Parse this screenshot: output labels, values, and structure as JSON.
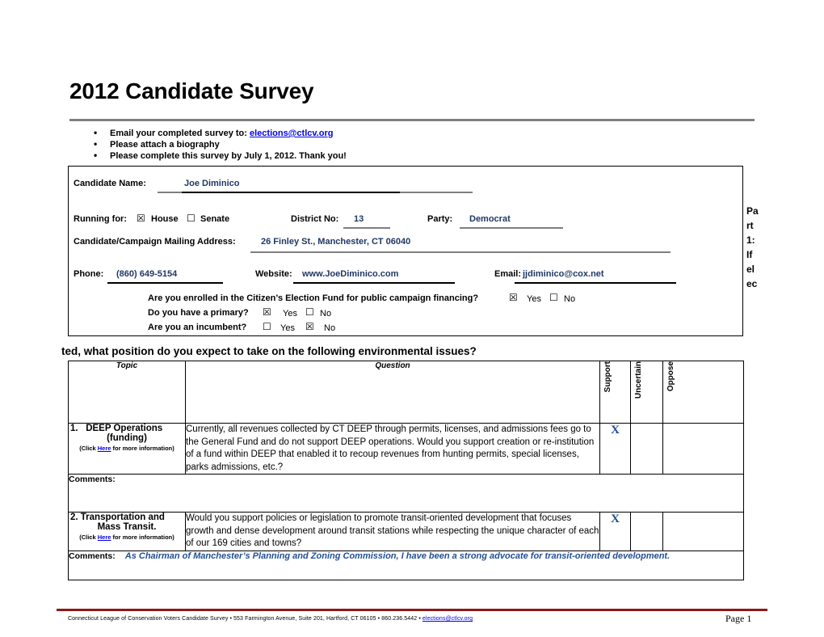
{
  "document": {
    "title": "2012 Candidate Survey",
    "instructions": [
      {
        "bullet": "•",
        "text_before": "Email your completed survey to: ",
        "link": "elections@ctlcv.org"
      },
      {
        "bullet": "•",
        "text_before": "Please attach a biography",
        "link": ""
      },
      {
        "bullet": "•",
        "text_before": "Please complete this survey by July 1, 2012.  Thank you!",
        "link": ""
      }
    ]
  },
  "candidate": {
    "name_label": "Candidate Name:",
    "name_value": "Joe Diminico",
    "running_for_label": "Running for:",
    "house_box": "☒",
    "house_label": "House",
    "senate_box": "☐",
    "senate_label": "Senate",
    "district_label": "District No:",
    "district_value": "13",
    "party_label": "Party:",
    "party_value": "Democrat",
    "address_label": "Candidate/Campaign Mailing Address:",
    "address_value": "26 Finley St., Manchester, CT 06040",
    "phone_label": "Phone:",
    "phone_value": "(860) 649-5154",
    "website_label": "Website:",
    "website_value": "www.JoeDiminico.com",
    "email_label": "Email:",
    "email_value": "jjdiminico@cox.net",
    "cef_question": "Are you enrolled in the Citizen’s Election Fund for public campaign financing?",
    "cef_yes_box": "☒",
    "cef_yes_label": "Yes",
    "cef_no_box": "☐",
    "cef_no_label": "No",
    "primary_question": "Do you have a primary?",
    "primary_yes_box": "☒",
    "primary_yes_label": "Yes",
    "primary_no_box": "☐",
    "primary_no_label": "No",
    "incumbent_question": "Are you an incumbent?",
    "incumbent_yes_box": "☐",
    "incumbent_yes_label": "Yes",
    "incumbent_no_box": "☒",
    "incumbent_no_label": "No"
  },
  "part_label": "Part 1: If elec",
  "continuation": "ted, what position do you expect to take on the following environmental issues?",
  "table": {
    "headers": {
      "topic": "Topic",
      "question": "Question",
      "support": "Support",
      "uncertain": "Uncertain",
      "oppose": "Oppose"
    },
    "rows": [
      {
        "number": "1.",
        "topic": "DEEP Operations",
        "topic_line2": "(funding)",
        "clicknote_before": "(Click ",
        "clicknote_link": "Here",
        "clicknote_after": " for more information)",
        "question": "Currently, all revenues collected by CT DEEP through permits, licenses, and admissions fees go to the General Fund and do not support DEEP operations.  Would you support creation or re-institution of a fund within DEEP that enabled it to recoup revenues from hunting permits, special licenses, parks admissions, etc.?",
        "support_mark": "X",
        "uncertain_mark": "",
        "oppose_mark": "",
        "comments_label": "Comments:",
        "comments_value": ""
      },
      {
        "number": "2.",
        "topic": "Transportation and",
        "topic_line2": "Mass Transit.",
        "clicknote_before": "(Click ",
        "clicknote_link": "Here",
        "clicknote_after": " for more information)",
        "question": "Would you support policies or legislation to promote transit-oriented development that focuses growth and dense development around transit stations while respecting the unique character of each of our 169 cities and towns?",
        "support_mark": "X",
        "uncertain_mark": "",
        "oppose_mark": "",
        "comments_label": "Comments:",
        "comments_value": "As Chairman of Manchester’s Planning and Zoning Commission, I have been a strong advocate for transit-oriented development."
      }
    ]
  },
  "footer": {
    "text_before": "Connecticut League of Conservation Voters Candidate Survey • 553 Farmington Avenue, Suite 201, Hartford, CT 06105 • 860.236.5442 • ",
    "link": "elections@ctlcv.org",
    "page_number": "Page 1"
  },
  "colors": {
    "ink_blue": "#1f4e96",
    "link_blue": "#0000ee",
    "rule_gray": "#808080",
    "footer_red": "#8b1a1a"
  }
}
